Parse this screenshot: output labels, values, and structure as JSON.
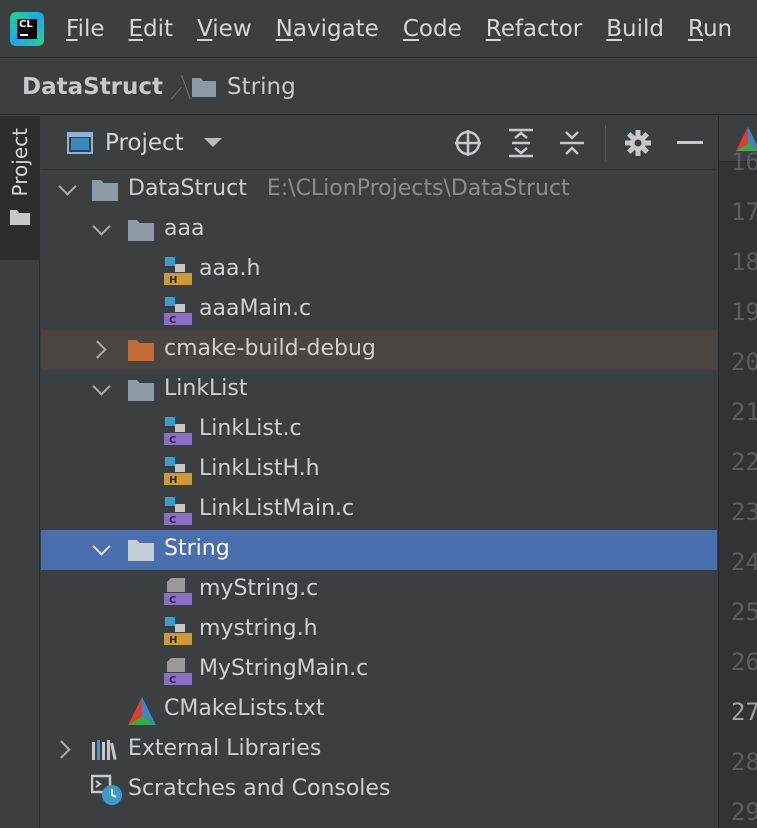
{
  "menubar": {
    "logo_text": "CL",
    "items": [
      {
        "mnemonic": "F",
        "rest": "ile"
      },
      {
        "mnemonic": "E",
        "rest": "dit"
      },
      {
        "mnemonic": "V",
        "rest": "iew"
      },
      {
        "mnemonic": "N",
        "rest": "avigate"
      },
      {
        "mnemonic": "C",
        "rest": "ode"
      },
      {
        "mnemonic": "R",
        "rest": "efactor"
      },
      {
        "mnemonic": "B",
        "rest": "uild"
      },
      {
        "mnemonic": "R",
        "rest": "un"
      }
    ]
  },
  "breadcrumb": {
    "root": "DataStruct",
    "leaf": "String"
  },
  "tool_stripe": {
    "label": "Project"
  },
  "panel": {
    "title": "Project"
  },
  "tree": {
    "rows": [
      {
        "label": "DataStruct",
        "path": "E:\\CLionProjects\\DataStruct"
      },
      {
        "label": "aaa"
      },
      {
        "label": "aaa.h"
      },
      {
        "label": "aaaMain.c"
      },
      {
        "label": "cmake-build-debug"
      },
      {
        "label": "LinkList"
      },
      {
        "label": "LinkList.c"
      },
      {
        "label": "LinkListH.h"
      },
      {
        "label": "LinkListMain.c"
      },
      {
        "label": "String"
      },
      {
        "label": "myString.c"
      },
      {
        "label": "mystring.h"
      },
      {
        "label": "MyStringMain.c"
      },
      {
        "label": "CMakeLists.txt"
      },
      {
        "label": "External Libraries"
      },
      {
        "label": "Scratches and Consoles"
      }
    ]
  },
  "editor": {
    "line_numbers": [
      "16",
      "17",
      "18",
      "19",
      "20",
      "21",
      "22",
      "23",
      "24",
      "25",
      "26",
      "27",
      "28",
      "29"
    ],
    "current_line": "27"
  },
  "colors": {
    "background": "#3c3f41",
    "selection": "#4b6eaf",
    "excluded_folder_highlight": "#4a4540",
    "folder": "#8e9aa3",
    "excluded_folder": "#c46c36",
    "header_badge": "#c99a3a",
    "c_badge": "#8a6fc4",
    "file_blue": "#3e9ac9"
  }
}
